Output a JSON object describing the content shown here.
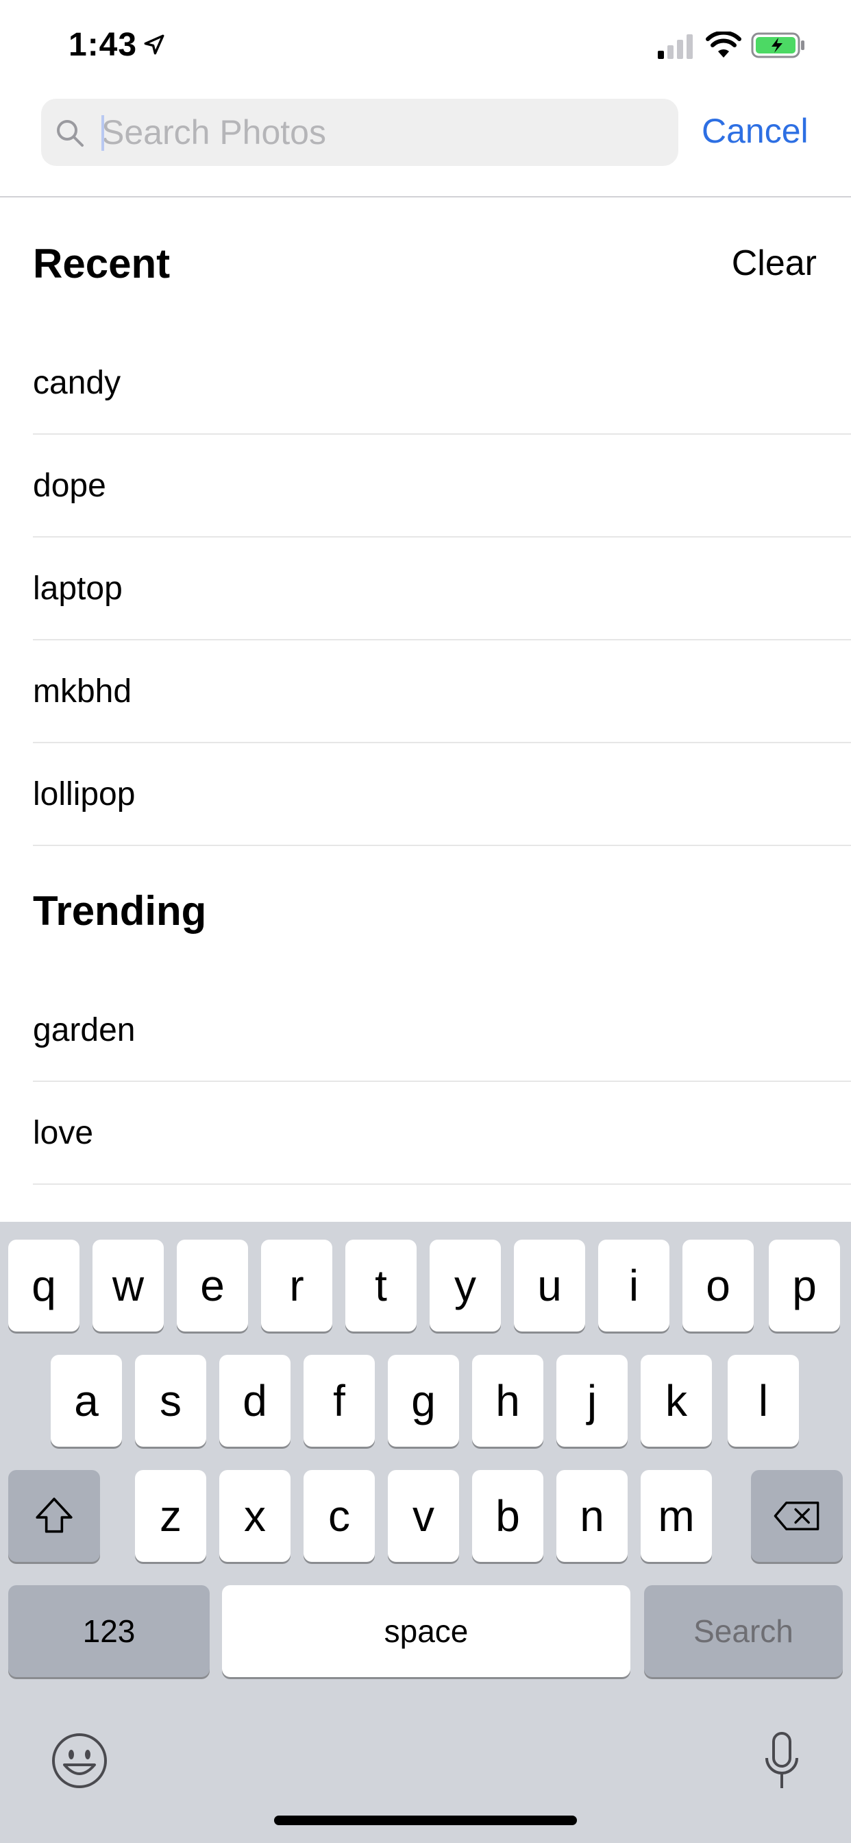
{
  "status_bar": {
    "time": "1:43"
  },
  "search": {
    "placeholder": "Search Photos",
    "value": "",
    "cancel_label": "Cancel"
  },
  "recent": {
    "title": "Recent",
    "clear_label": "Clear",
    "items": [
      "candy",
      "dope",
      "laptop",
      "mkbhd",
      "lollipop"
    ]
  },
  "trending": {
    "title": "Trending",
    "items": [
      "garden",
      "love"
    ]
  },
  "keyboard": {
    "row1": [
      "q",
      "w",
      "e",
      "r",
      "t",
      "y",
      "u",
      "i",
      "o",
      "p"
    ],
    "row2": [
      "a",
      "s",
      "d",
      "f",
      "g",
      "h",
      "j",
      "k",
      "l"
    ],
    "row3": [
      "z",
      "x",
      "c",
      "v",
      "b",
      "n",
      "m"
    ],
    "numbers_label": "123",
    "space_label": "space",
    "search_label": "Search"
  },
  "colors": {
    "accent": "#2d6fe3",
    "keyboard_bg": "#d1d4da",
    "battery": "#4cd964"
  }
}
